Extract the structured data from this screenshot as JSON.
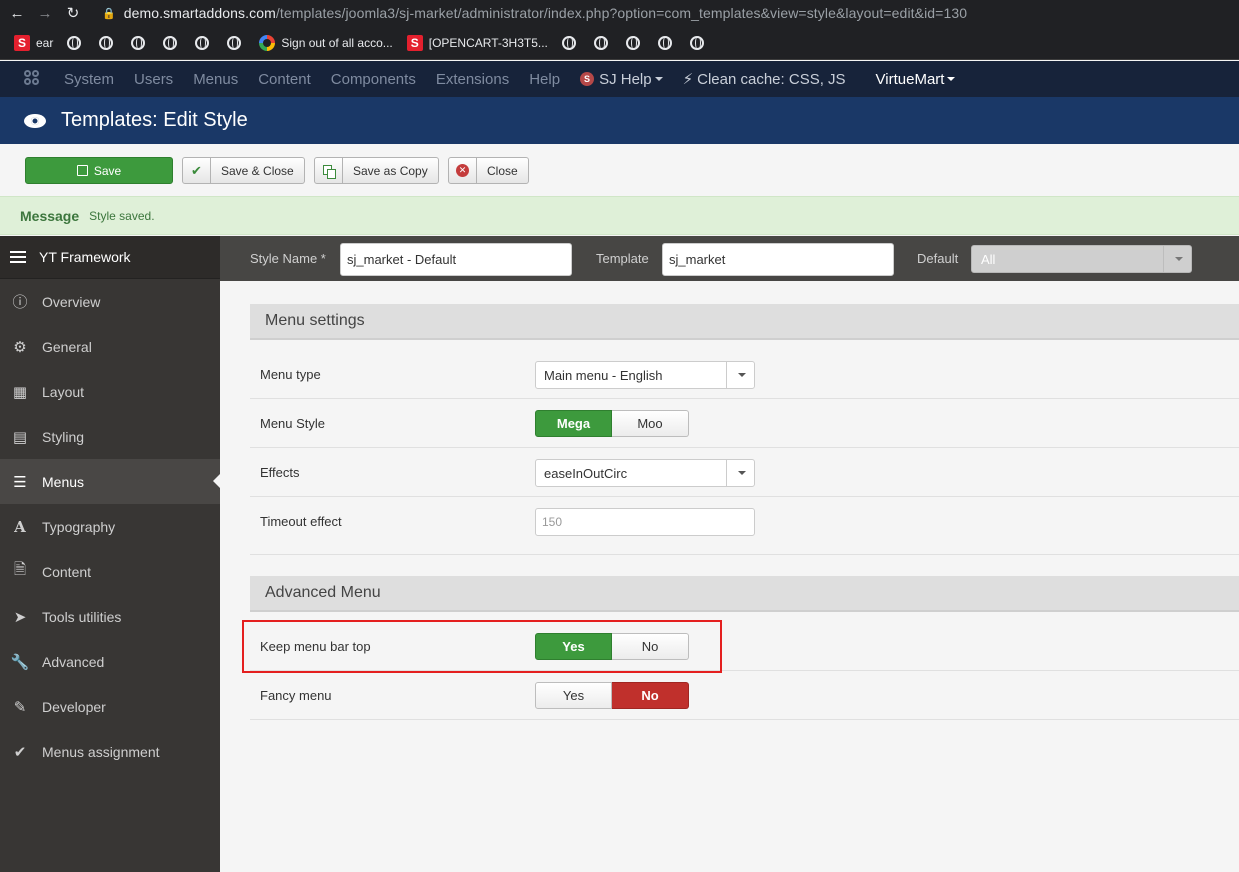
{
  "browser": {
    "url_host": "demo.smartaddons.com",
    "url_path": "/templates/joomla3/sj-market/administrator/index.php?option=com_templates&view=style&layout=edit&id=130",
    "bookmarks": [
      {
        "type": "s",
        "label": "ear"
      },
      {
        "type": "globe",
        "label": ""
      },
      {
        "type": "globe",
        "label": ""
      },
      {
        "type": "globe",
        "label": ""
      },
      {
        "type": "globe",
        "label": ""
      },
      {
        "type": "globe",
        "label": ""
      },
      {
        "type": "globe",
        "label": ""
      },
      {
        "type": "google",
        "label": "Sign out of all acco..."
      },
      {
        "type": "s",
        "label": "[OPENCART-3H3T5..."
      },
      {
        "type": "globe",
        "label": ""
      },
      {
        "type": "globe",
        "label": ""
      },
      {
        "type": "globe",
        "label": ""
      },
      {
        "type": "globe",
        "label": ""
      },
      {
        "type": "globe",
        "label": ""
      }
    ]
  },
  "adminbar": {
    "items": [
      "System",
      "Users",
      "Menus",
      "Content",
      "Components",
      "Extensions",
      "Help"
    ],
    "sj_help": "SJ Help",
    "clean_cache": "Clean cache: CSS, JS",
    "virtuemart": "VirtueMart"
  },
  "title": "Templates: Edit Style",
  "toolbar": {
    "save": "Save",
    "save_close": "Save & Close",
    "save_copy": "Save as Copy",
    "close": "Close"
  },
  "message": {
    "heading": "Message",
    "text": "Style saved."
  },
  "sidebar": {
    "header": "YT Framework",
    "items": [
      {
        "label": "Overview",
        "icon": "info-icon"
      },
      {
        "label": "General",
        "icon": "gear-icon"
      },
      {
        "label": "Layout",
        "icon": "grid-icon"
      },
      {
        "label": "Styling",
        "icon": "card-icon"
      },
      {
        "label": "Menus",
        "icon": "list-icon",
        "active": true
      },
      {
        "label": "Typography",
        "icon": "font-icon"
      },
      {
        "label": "Content",
        "icon": "document-icon"
      },
      {
        "label": "Tools utilities",
        "icon": "paper-plane-icon"
      },
      {
        "label": "Advanced",
        "icon": "wrench-icon"
      },
      {
        "label": "Developer",
        "icon": "pencil-icon"
      },
      {
        "label": "Menus assignment",
        "icon": "check-icon"
      }
    ]
  },
  "stylebar": {
    "style_name_label": "Style Name *",
    "style_name_value": "sj_market - Default",
    "template_label": "Template",
    "template_value": "sj_market",
    "default_label": "Default",
    "default_value": "All"
  },
  "menu_settings": {
    "heading": "Menu settings",
    "menu_type_label": "Menu type",
    "menu_type_value": "Main menu - English",
    "menu_style_label": "Menu Style",
    "menu_style_options": [
      "Mega",
      "Moo"
    ],
    "effects_label": "Effects",
    "effects_value": "easeInOutCirc",
    "timeout_label": "Timeout effect",
    "timeout_placeholder": "150"
  },
  "advanced_menu": {
    "heading": "Advanced Menu",
    "keep_label": "Keep menu bar top",
    "keep_options": [
      "Yes",
      "No"
    ],
    "fancy_label": "Fancy menu",
    "fancy_options": [
      "Yes",
      "No"
    ]
  },
  "colors": {
    "accent_green": "#3d9a3d",
    "accent_red": "#c0302c",
    "highlight_box": "#e41f1f"
  }
}
